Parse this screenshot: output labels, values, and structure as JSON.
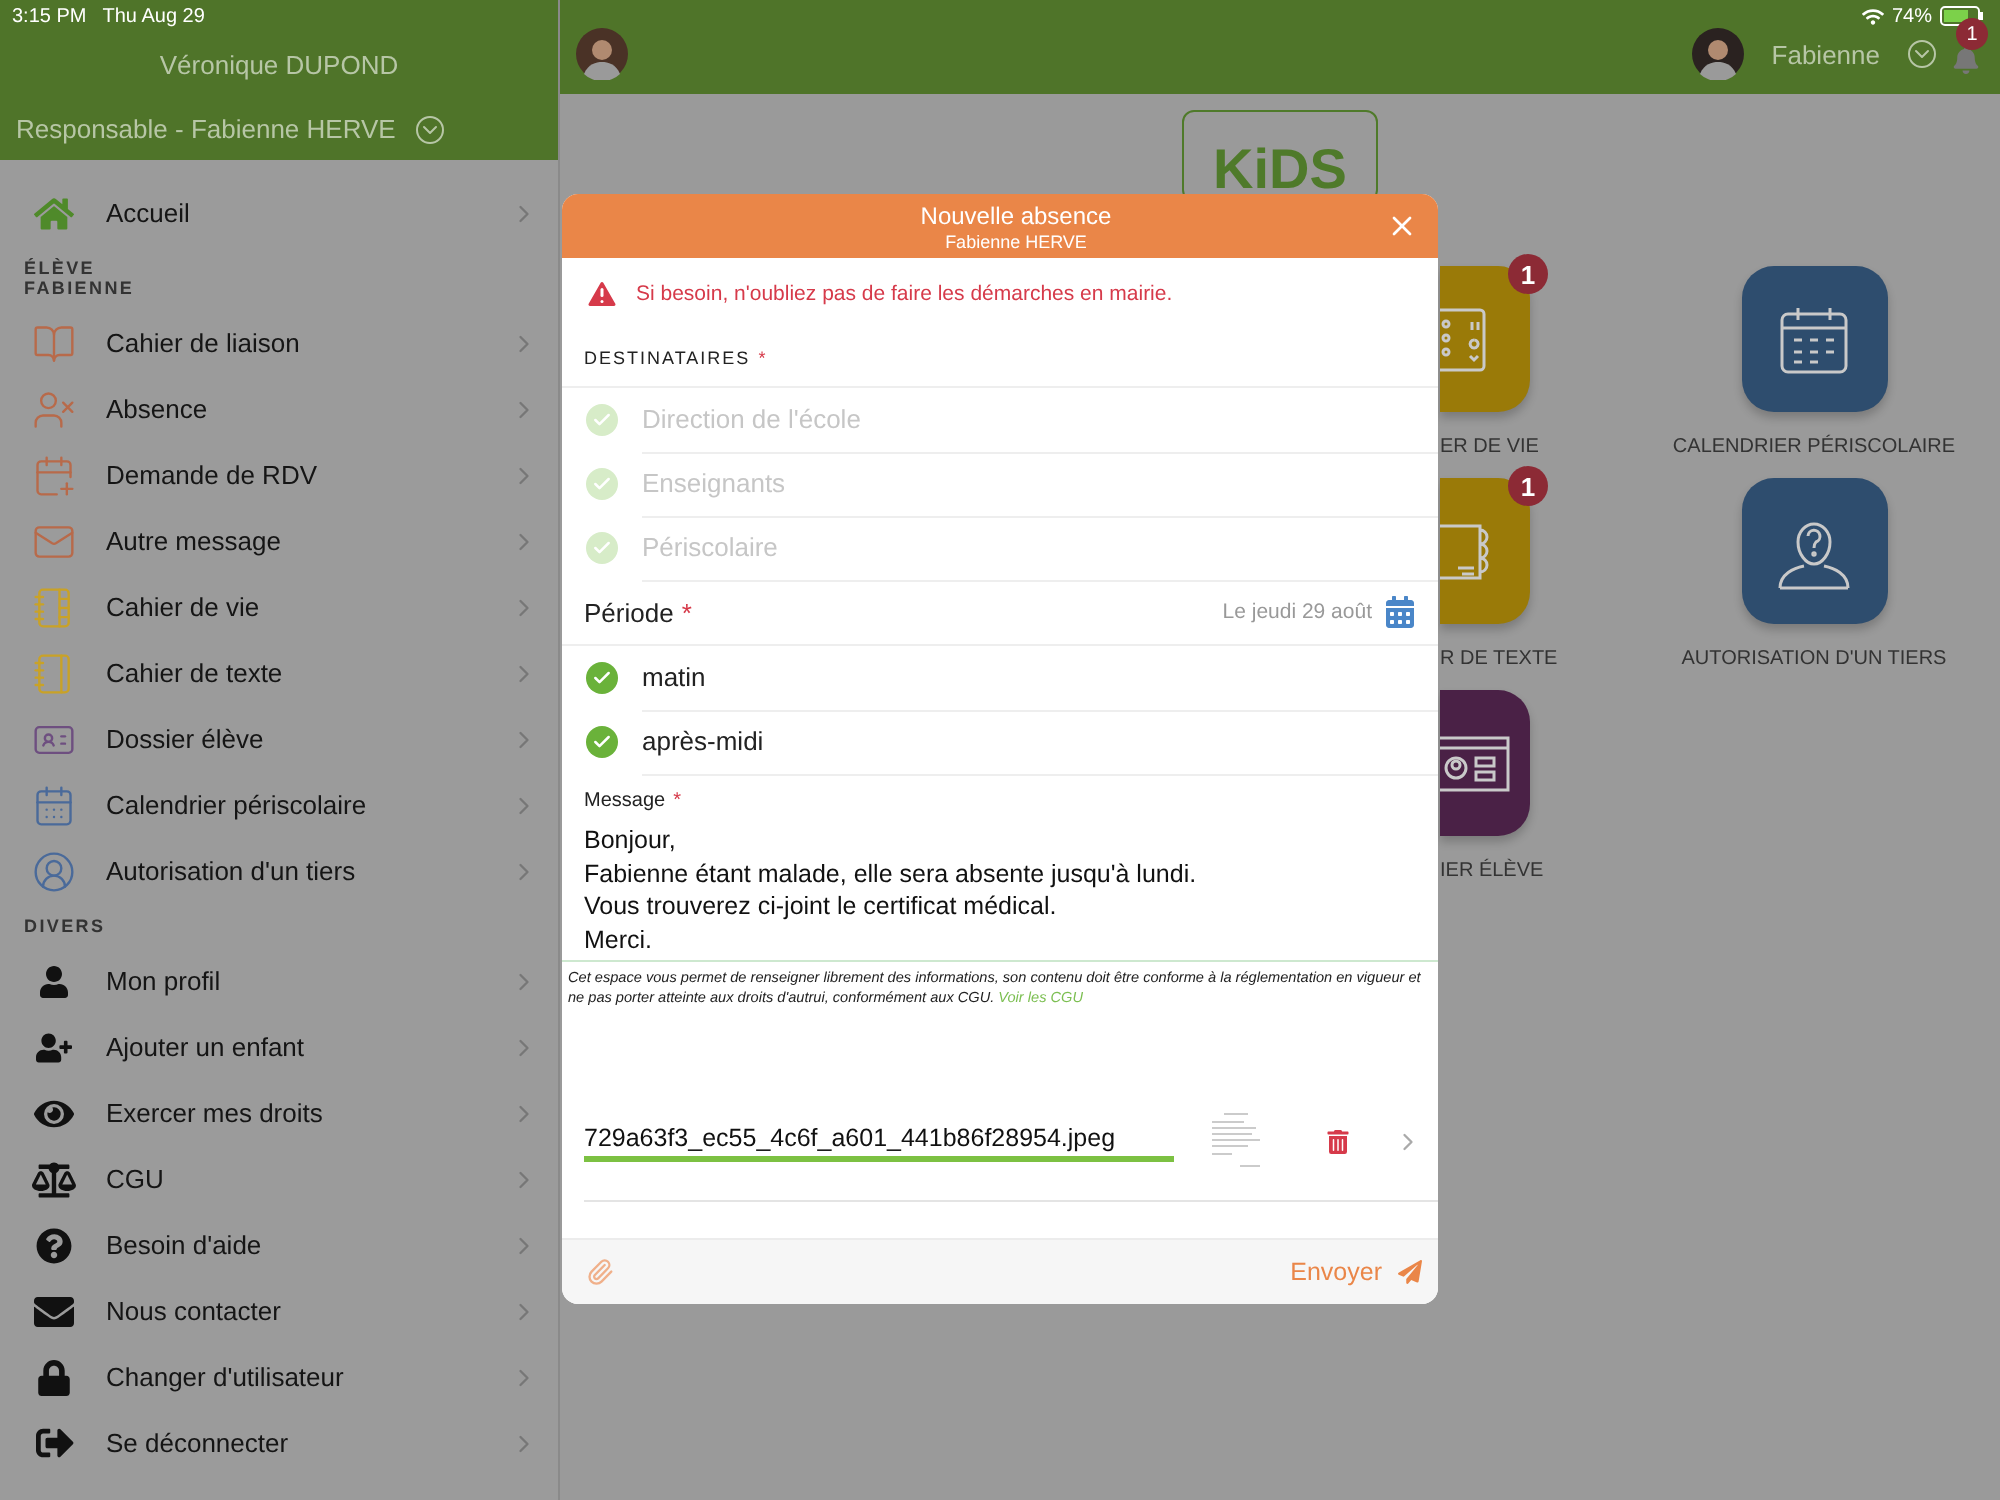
{
  "status_bar": {
    "time": "3:15 PM",
    "date": "Thu Aug 29",
    "battery": "74%"
  },
  "sidebar": {
    "title": "Véronique DUPOND",
    "subtitle": "Responsable - Fabienne HERVE",
    "home": {
      "label": "Accueil"
    },
    "sections": [
      {
        "heading": [
          "ÉLÈVE",
          "FABIENNE"
        ],
        "items": [
          {
            "label": "Cahier de liaison"
          },
          {
            "label": "Absence"
          },
          {
            "label": "Demande de RDV"
          },
          {
            "label": "Autre message"
          },
          {
            "label": "Cahier de vie"
          },
          {
            "label": "Cahier de texte"
          },
          {
            "label": "Dossier élève"
          },
          {
            "label": "Calendrier périscolaire"
          },
          {
            "label": "Autorisation d'un tiers"
          }
        ]
      },
      {
        "heading": [
          "DIVERS"
        ],
        "items": [
          {
            "label": "Mon profil"
          },
          {
            "label": "Ajouter un enfant"
          },
          {
            "label": "Exercer mes droits"
          },
          {
            "label": "CGU"
          },
          {
            "label": "Besoin d'aide"
          },
          {
            "label": "Nous contacter"
          },
          {
            "label": "Changer d'utilisateur"
          },
          {
            "label": "Se déconnecter"
          }
        ]
      }
    ]
  },
  "header": {
    "child_name": "Fabienne",
    "notifications": "1"
  },
  "logo": {
    "text": "KiDS"
  },
  "tiles": [
    {
      "label": "ER DE VIE",
      "badge": "1",
      "color": "#9a7a08",
      "kind": "life"
    },
    {
      "label": "CALENDRIER PÉRISCOLAIRE",
      "color": "#2e4d6e",
      "kind": "calendar"
    },
    {
      "label": "R DE TEXTE",
      "badge": "1",
      "color": "#9a7a08",
      "kind": "homework"
    },
    {
      "label": "AUTORISATION D'UN TIERS",
      "color": "#2e4d6e",
      "kind": "person"
    },
    {
      "label": "IER ÉLÈVE",
      "color": "#4a2146",
      "kind": "card"
    }
  ],
  "modal": {
    "title": "Nouvelle absence",
    "subtitle": "Fabienne HERVE",
    "warning": "Si besoin, n'oubliez pas de faire les démarches en mairie.",
    "recipients": {
      "label": "DESTINATAIRES",
      "required": "*",
      "items": [
        {
          "label": "Direction de l'école",
          "checked": true,
          "disabled": true
        },
        {
          "label": "Enseignants",
          "checked": true,
          "disabled": true
        },
        {
          "label": "Périscolaire",
          "checked": true,
          "disabled": true
        }
      ]
    },
    "period": {
      "label": "Période",
      "required": "*",
      "date": "Le jeudi 29 août",
      "items": [
        {
          "label": "matin",
          "checked": true,
          "disabled": false
        },
        {
          "label": "après-midi",
          "checked": true,
          "disabled": false
        }
      ]
    },
    "message": {
      "label": "Message",
      "required": "*",
      "value": "Bonjour,\nFabienne étant malade, elle sera absente jusqu'à lundi.\nVous trouverez ci-joint le certificat médical.\nMerci."
    },
    "disclaimer": "Cet espace vous permet de renseigner librement des informations, son contenu doit être conforme à la réglementation en vigueur et ne pas porter atteinte aux droits d'autrui, conformément aux CGU.",
    "disclaimer_link": "Voir les CGU",
    "attachment": {
      "filename": "729a63f3_ec55_4c6f_a601_441b86f28954.jpeg"
    },
    "send": "Envoyer"
  }
}
